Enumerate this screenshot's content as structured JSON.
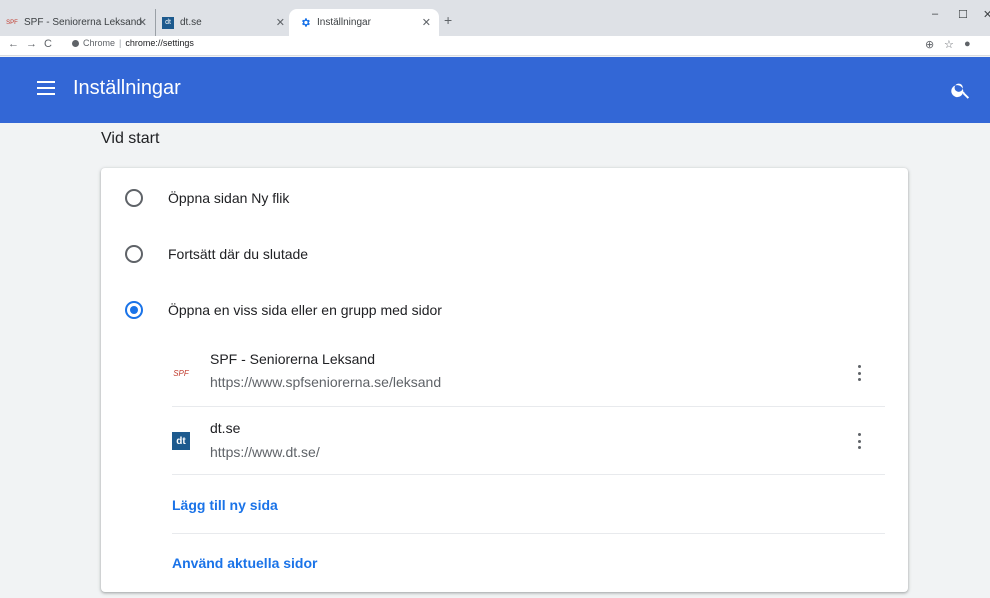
{
  "tabs": [
    {
      "title": "SPF - Seniorerna Leksand",
      "favicon": "SPF"
    },
    {
      "title": "dt.se",
      "favicon": "dt"
    },
    {
      "title": "Inställningar",
      "favicon": "gear"
    }
  ],
  "toolbar": {
    "origin_label": "Chrome",
    "url": "chrome://settings"
  },
  "header": {
    "title": "Inställningar"
  },
  "section": {
    "title": "Vid start"
  },
  "startup_options": [
    {
      "label": "Öppna sidan Ny flik",
      "checked": false
    },
    {
      "label": "Fortsätt där du slutade",
      "checked": false
    },
    {
      "label": "Öppna en viss sida eller en grupp med sidor",
      "checked": true
    }
  ],
  "pages": [
    {
      "name": "SPF - Seniorerna Leksand",
      "url": "https://www.spfseniorerna.se/leksand",
      "favicon": "SPF"
    },
    {
      "name": "dt.se",
      "url": "https://www.dt.se/",
      "favicon": "dt"
    }
  ],
  "actions": {
    "add_page": "Lägg till ny sida",
    "use_current": "Använd aktuella sidor"
  },
  "colors": {
    "header": "#3367d6",
    "accent": "#1a73e8",
    "dt_favicon": "#1d5a8e"
  }
}
